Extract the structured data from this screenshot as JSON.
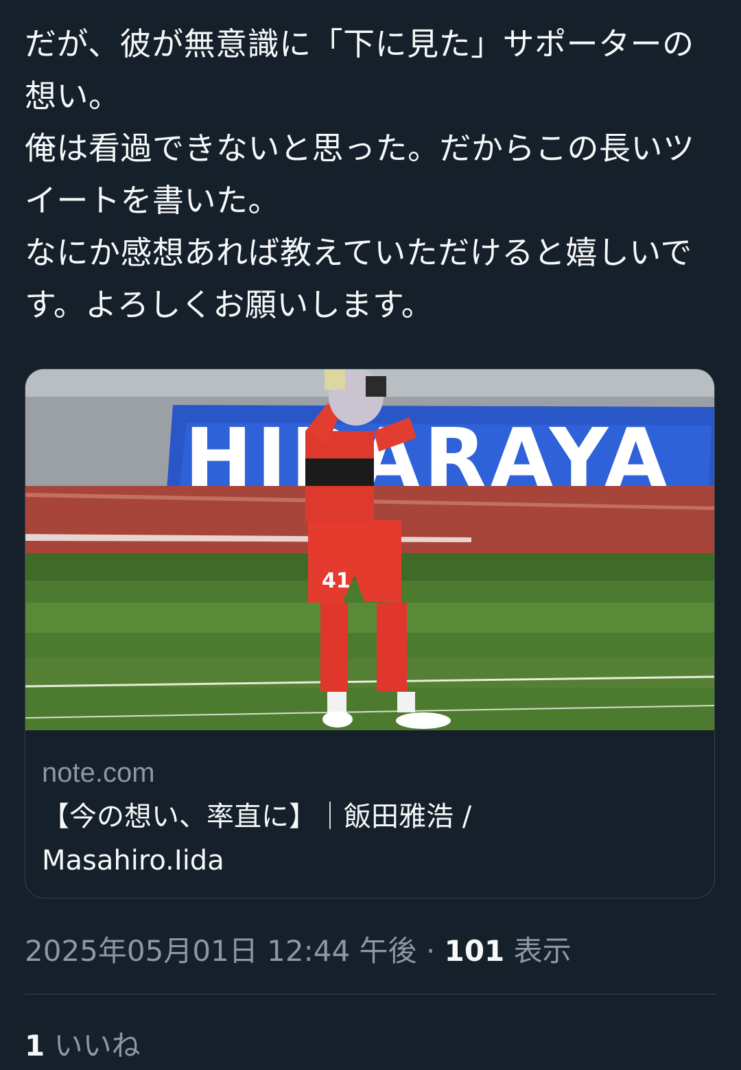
{
  "tweet": {
    "lines": [
      "だが、彼が無意識に「下に見た」サポーターの想い。",
      "俺は看過できないと思った。だからこの長いツイートを書いた。",
      "なにか感想あれば教えていただけると嬉しいです。よろしくお願いします。"
    ]
  },
  "card": {
    "image_alt": "ゴールキーパーの写真",
    "banner_text": "HIRARAYA",
    "shorts_number": "41",
    "domain": "note.com",
    "title": "【今の想い、率直に】｜飯田雅浩 / Masahiro.Iida"
  },
  "meta": {
    "timestamp": "2025年05月01日 12:44 午後",
    "separator": "·",
    "views_count": "101",
    "views_label": "表示"
  },
  "likes": {
    "count": "1",
    "label": "いいね"
  },
  "colors": {
    "background": "#15202b",
    "text": "#f7f9f9",
    "secondary_text": "#8b98a5",
    "border": "#38444d"
  }
}
